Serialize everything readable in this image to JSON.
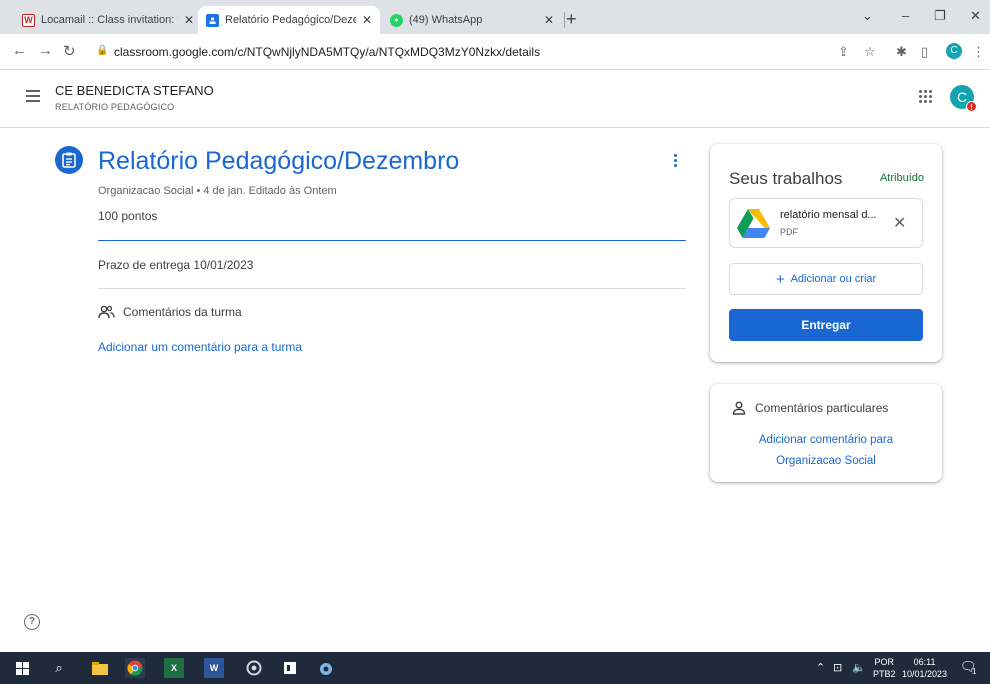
{
  "browser": {
    "tabs": [
      {
        "title": "Locamail :: Class invitation: \"CE B",
        "favicon": "W",
        "color": "#c5221f"
      },
      {
        "title": "Relatório Pedagógico/Dezembro",
        "favicon": "classroom-icon",
        "color": "#1a73e8"
      },
      {
        "title": "(49) WhatsApp",
        "favicon": "whatsapp-icon",
        "color": "#25d366"
      }
    ],
    "url": "classroom.google.com/c/NTQwNjlyNDA5MTQy/a/NTQxMDQ3MzY0Nzkx/details",
    "profile_initial": "C"
  },
  "header": {
    "class_name": "CE BENEDICTA STEFANO",
    "subtitle": "RELATÓRIO PEDAGÓGICO",
    "avatar_initial": "C"
  },
  "assignment": {
    "title": "Relatório Pedagógico/Dezembro",
    "meta": "Organizacao Social • 4 de jan. Editado às Ontem",
    "points": "100 pontos",
    "due": "Prazo de entrega 10/01/2023",
    "class_comments_label": "Comentários da turma",
    "add_class_comment": "Adicionar um comentário para a turma"
  },
  "your_work": {
    "title": "Seus trabalhos",
    "status": "Atribuído",
    "attachment": {
      "name": "relatório mensal d...",
      "type": "PDF",
      "icon": "google-drive-icon"
    },
    "add_or_create": "Adicionar ou criar",
    "submit": "Entregar"
  },
  "private_comments": {
    "label": "Comentários particulares",
    "link_line1": "Adicionar comentário para",
    "link_line2": "Organizacao Social"
  },
  "taskbar": {
    "lang_line1": "POR",
    "lang_line2": "PTB2",
    "time": "06:11",
    "date": "10/01/2023",
    "notification_count": "1"
  },
  "colors": {
    "accent": "#1967d2",
    "status_green": "#137333",
    "taskbar": "#1f2a3a"
  }
}
